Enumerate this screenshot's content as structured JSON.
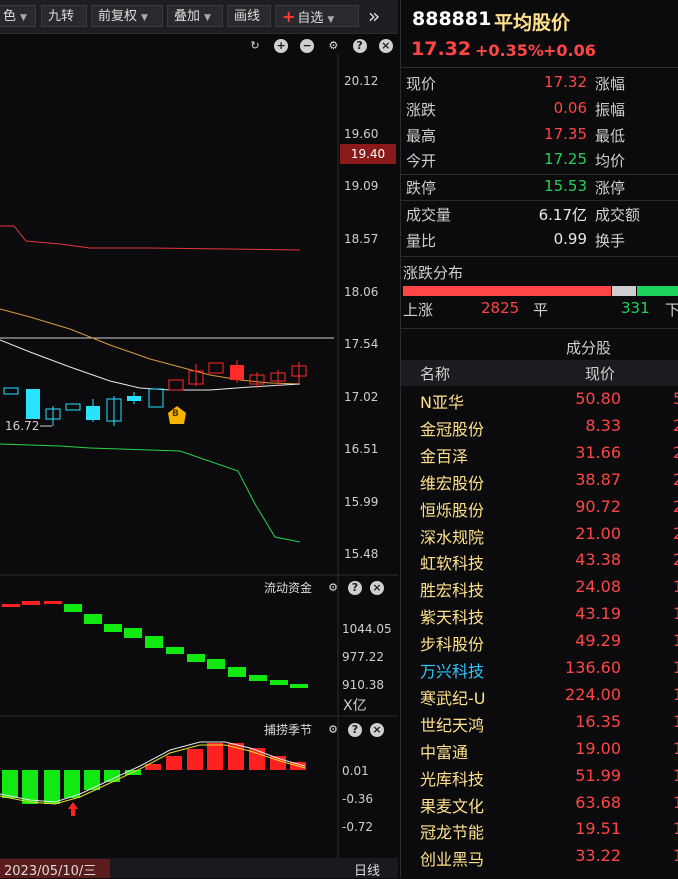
{
  "toolbar": {
    "items": [
      "色",
      "九转",
      "前复权",
      "叠加",
      "画线"
    ],
    "add_label": "自选",
    "more": "»"
  },
  "chart": {
    "top_icons": [
      "↻",
      "+",
      "−",
      "⚙",
      "?",
      "×"
    ],
    "price_ticks": [
      "20.12",
      "19.60",
      "19.09",
      "18.57",
      "18.06",
      "17.54",
      "17.02",
      "16.51",
      "15.99",
      "15.48"
    ],
    "current_price_tag": "19.40",
    "low_marker": "16.72",
    "b_marker": "B",
    "fund_panel": {
      "title": "流动资金",
      "ticks": [
        "1044.05",
        "977.22",
        "910.38"
      ],
      "unit": "X亿"
    },
    "season_panel": {
      "title": "捕捞季节",
      "ticks": [
        "0.01",
        "-0.36",
        "-0.72"
      ]
    },
    "date_label": "2023/05/10/三",
    "period_label": "日线",
    "colors": {
      "up": "#ff2a2a",
      "down": "#29e2ff",
      "macd_up": "#ff2020",
      "macd_down": "#12e812"
    }
  },
  "header": {
    "code": "888881",
    "name": "平均股价",
    "price": "17.32",
    "change_pct": "+0.35%",
    "change": "+0.06"
  },
  "quote": [
    {
      "label": "现价",
      "value": "17.32",
      "color": "red",
      "right_label": "涨幅"
    },
    {
      "label": "涨跌",
      "value": "0.06",
      "color": "red",
      "right_label": "振幅"
    },
    {
      "label": "最高",
      "value": "17.35",
      "color": "red",
      "right_label": "最低"
    },
    {
      "label": "今开",
      "value": "17.25",
      "color": "green",
      "right_label": "均价"
    },
    {
      "label": "跌停",
      "value": "15.53",
      "color": "green",
      "right_label": "涨停"
    },
    {
      "label": "成交量",
      "value": "6.17亿",
      "color": "white",
      "right_label": "成交额"
    },
    {
      "label": "量比",
      "value": "0.99",
      "color": "white",
      "right_label": "换手"
    }
  ],
  "distribution": {
    "title": "涨跌分布",
    "up_label": "上涨",
    "up_count": "2825",
    "flat_label": "平",
    "flat_count": "331",
    "down_label": "下"
  },
  "constituents": {
    "title": "成分股",
    "col_name": "名称",
    "col_price": "现价",
    "rows": [
      {
        "name": "N亚华",
        "price": "50.80",
        "extra": "5",
        "name_color": "yellow"
      },
      {
        "name": "金冠股份",
        "price": "8.33",
        "extra": "2",
        "name_color": "yellow"
      },
      {
        "name": "金百泽",
        "price": "31.66",
        "extra": "2",
        "name_color": "yellow"
      },
      {
        "name": "维宏股份",
        "price": "38.87",
        "extra": "2",
        "name_color": "yellow"
      },
      {
        "name": "恒烁股份",
        "price": "90.72",
        "extra": "2",
        "name_color": "yellow"
      },
      {
        "name": "深水规院",
        "price": "21.00",
        "extra": "2",
        "name_color": "yellow"
      },
      {
        "name": "虹软科技",
        "price": "43.38",
        "extra": "2",
        "name_color": "yellow"
      },
      {
        "name": "胜宏科技",
        "price": "24.08",
        "extra": "1",
        "name_color": "yellow"
      },
      {
        "name": "紫天科技",
        "price": "43.19",
        "extra": "1",
        "name_color": "yellow"
      },
      {
        "name": "步科股份",
        "price": "49.29",
        "extra": "1",
        "name_color": "yellow"
      },
      {
        "name": "万兴科技",
        "price": "136.60",
        "extra": "1",
        "name_color": "cyan"
      },
      {
        "name": "寒武纪-U",
        "price": "224.00",
        "extra": "1",
        "name_color": "yellow"
      },
      {
        "name": "世纪天鸿",
        "price": "16.35",
        "extra": "1",
        "name_color": "yellow"
      },
      {
        "name": "中富通",
        "price": "19.00",
        "extra": "1",
        "name_color": "yellow"
      },
      {
        "name": "光库科技",
        "price": "51.99",
        "extra": "1",
        "name_color": "yellow"
      },
      {
        "name": "果麦文化",
        "price": "63.68",
        "extra": "1",
        "name_color": "yellow"
      },
      {
        "name": "冠龙节能",
        "price": "19.51",
        "extra": "1",
        "name_color": "yellow"
      },
      {
        "name": "创业黑马",
        "price": "33.22",
        "extra": "1",
        "name_color": "yellow"
      }
    ]
  }
}
